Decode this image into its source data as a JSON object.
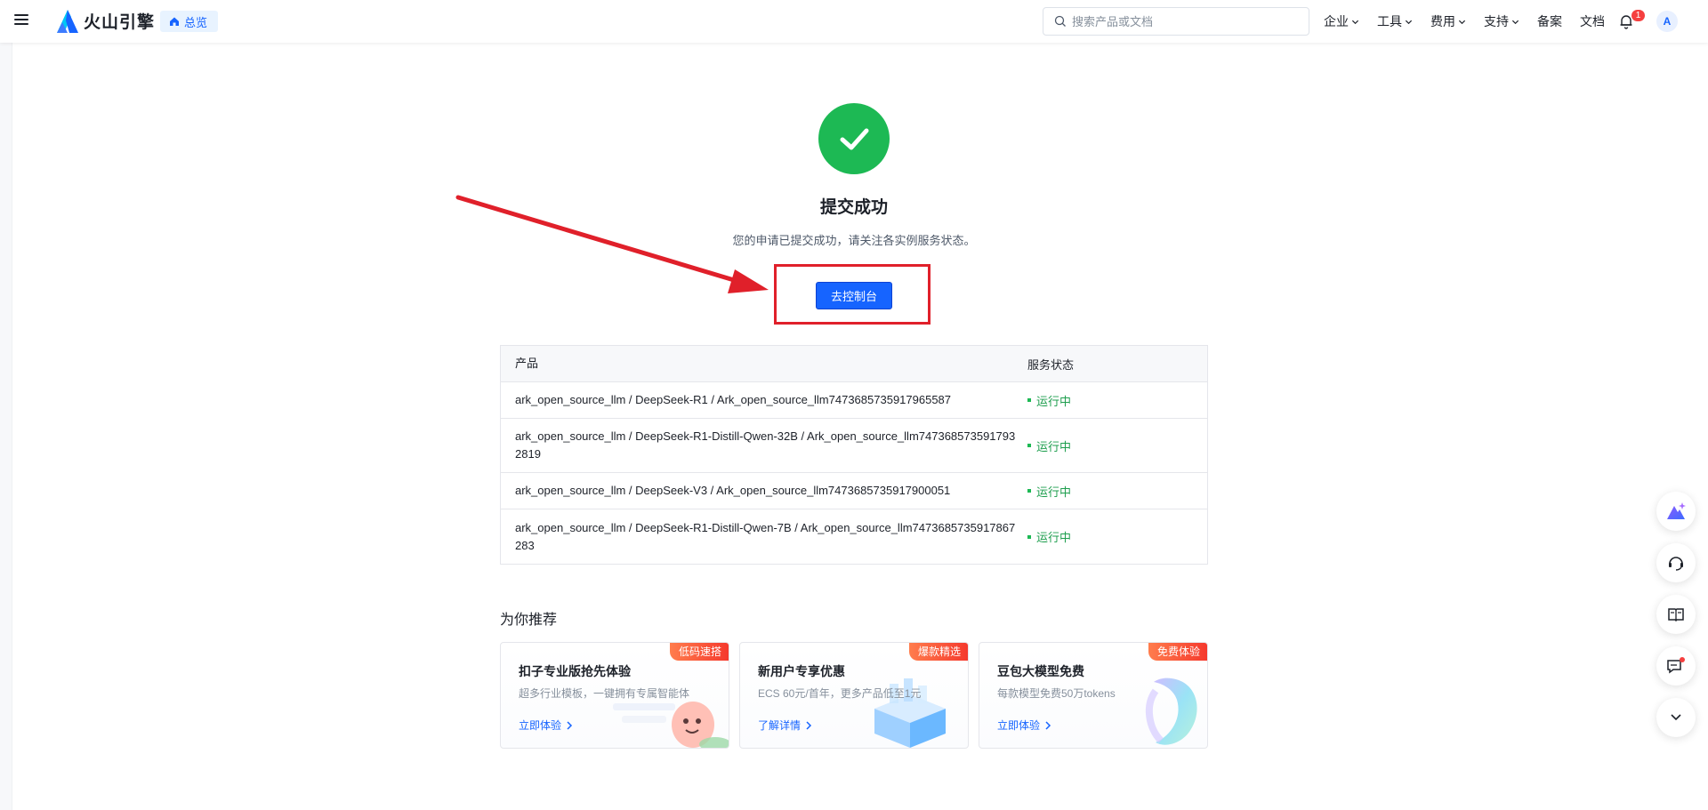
{
  "header": {
    "brand": "火山引擎",
    "overview_label": "总览",
    "search_placeholder": "搜索产品或文档",
    "nav": [
      "企业",
      "工具",
      "费用",
      "支持",
      "备案",
      "文档"
    ],
    "notification_count": "1",
    "avatar_letter": "A"
  },
  "result": {
    "title": "提交成功",
    "description": "您的申请已提交成功，请关注各实例服务状态。",
    "console_button": "去控制台"
  },
  "table": {
    "columns": [
      "产品",
      "服务状态"
    ],
    "rows": [
      {
        "product": "ark_open_source_llm / DeepSeek-R1 / Ark_open_source_llm7473685735917965587",
        "status": "运行中"
      },
      {
        "product": "ark_open_source_llm / DeepSeek-R1-Distill-Qwen-32B / Ark_open_source_llm7473685735917932819",
        "status": "运行中"
      },
      {
        "product": "ark_open_source_llm / DeepSeek-V3 / Ark_open_source_llm7473685735917900051",
        "status": "运行中"
      },
      {
        "product": "ark_open_source_llm / DeepSeek-R1-Distill-Qwen-7B / Ark_open_source_llm7473685735917867283",
        "status": "运行中"
      }
    ]
  },
  "recommend": {
    "title": "为你推荐",
    "cards": [
      {
        "tag": "低码速搭",
        "title": "扣子专业版抢先体验",
        "desc": "超多行业模板，一键拥有专属智能体",
        "link": "立即体验"
      },
      {
        "tag": "爆款精选",
        "title": "新用户专享优惠",
        "desc": "ECS 60元/首年，更多产品低至1元",
        "link": "了解详情"
      },
      {
        "tag": "免费体验",
        "title": "豆包大模型免费",
        "desc": "每款模型免费50万tokens",
        "link": "立即体验"
      }
    ]
  },
  "colors": {
    "primary": "#1664ff",
    "success": "#1db954",
    "annotation_red": "#e0202a",
    "tag_red": "#f5392d"
  },
  "floating_buttons": [
    "ai-assistant-icon",
    "customer-service-icon",
    "docs-book-icon",
    "feedback-icon",
    "collapse-chevron-icon"
  ]
}
